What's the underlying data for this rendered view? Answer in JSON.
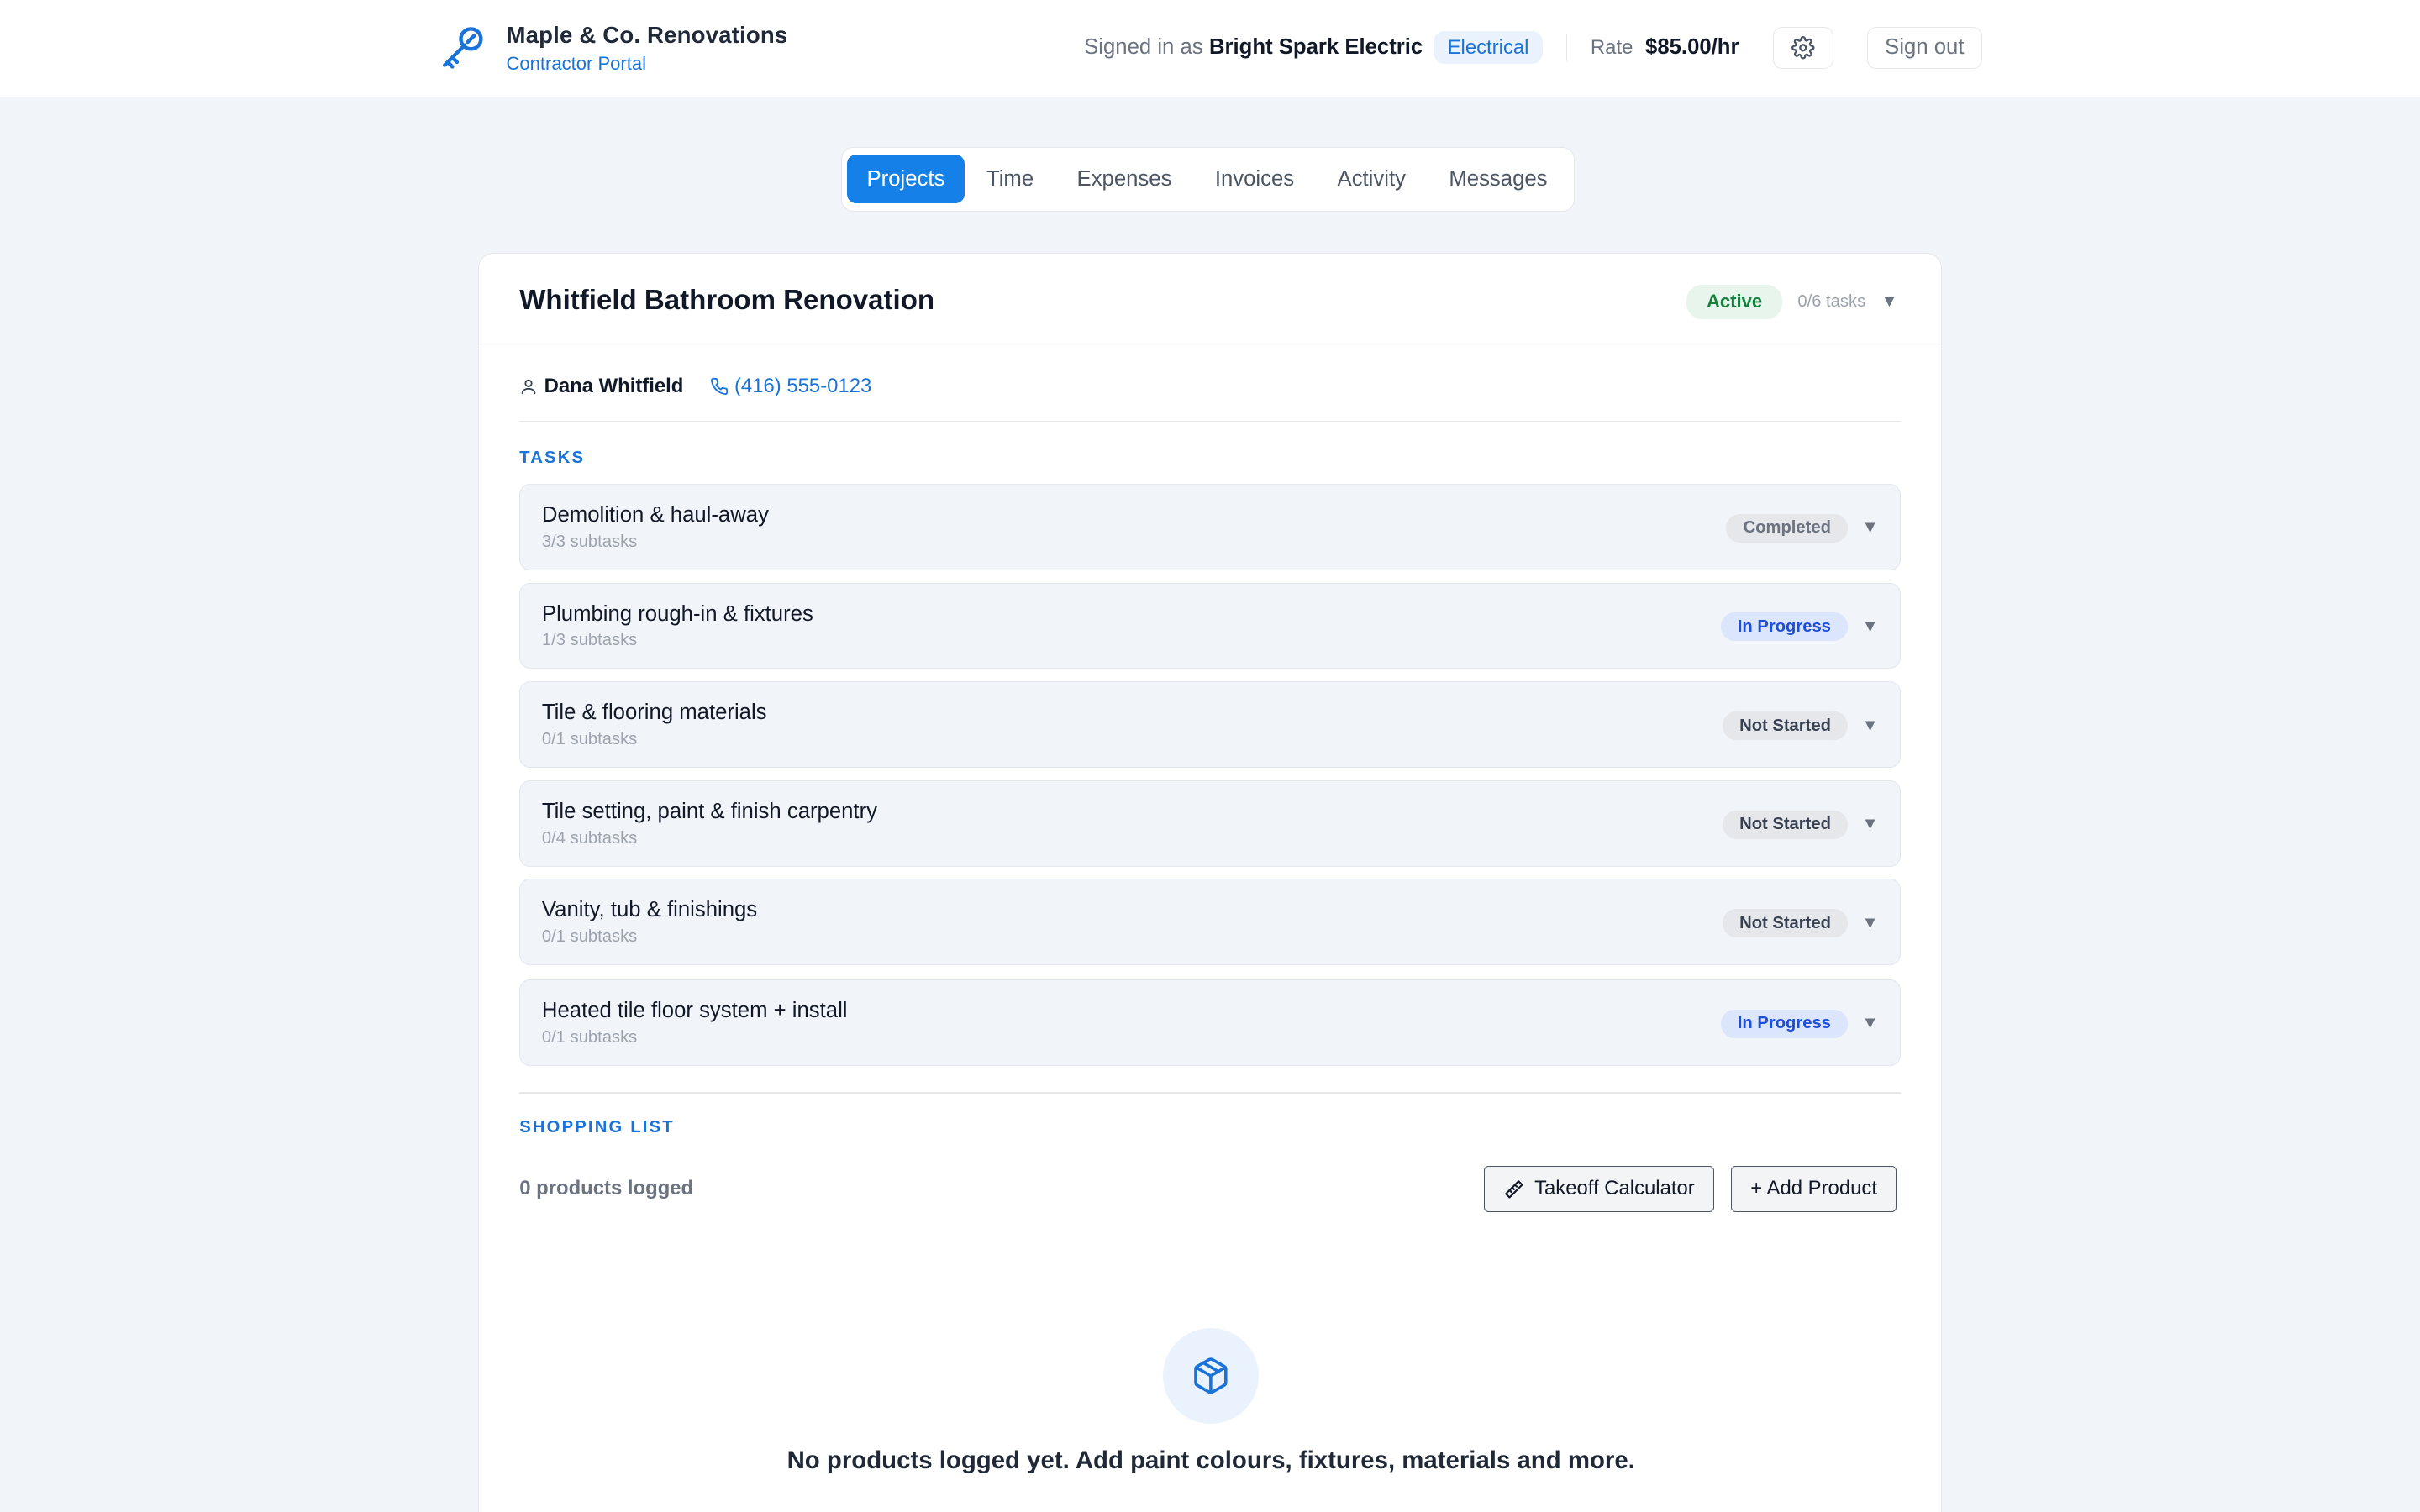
{
  "header": {
    "brand_name": "Maple & Co. Renovations",
    "brand_sub": "Contractor Portal",
    "signed_in_label": "Signed in as",
    "user_name": "Bright Spark Electric",
    "trade": "Electrical",
    "rate_label": "Rate",
    "rate_value": "$85.00/hr",
    "sign_out": "Sign out",
    "settings_icon": "gear-icon",
    "brand_icon": "key-icon"
  },
  "tabs": [
    {
      "label": "Projects",
      "active": true
    },
    {
      "label": "Time",
      "active": false
    },
    {
      "label": "Expenses",
      "active": false
    },
    {
      "label": "Invoices",
      "active": false
    },
    {
      "label": "Activity",
      "active": false
    },
    {
      "label": "Messages",
      "active": false
    }
  ],
  "project": {
    "title": "Whitfield Bathroom Renovation",
    "status": "Active",
    "task_count": "0/6 tasks",
    "client_name": "Dana Whitfield",
    "client_phone": "(416) 555-0123"
  },
  "tasks_section": {
    "label": "TASKS",
    "items": [
      {
        "name": "Demolition & haul-away",
        "subtasks": "3/3 subtasks",
        "status": "Completed"
      },
      {
        "name": "Plumbing rough-in & fixtures",
        "subtasks": "1/3 subtasks",
        "status": "In Progress"
      },
      {
        "name": "Tile & flooring materials",
        "subtasks": "0/1 subtasks",
        "status": "Not Started"
      },
      {
        "name": "Tile setting, paint & finish carpentry",
        "subtasks": "0/4 subtasks",
        "status": "Not Started"
      },
      {
        "name": "Vanity, tub & finishings",
        "subtasks": "0/1 subtasks",
        "status": "Not Started"
      },
      {
        "name": "Heated tile floor system + install",
        "subtasks": "0/1 subtasks",
        "status": "In Progress"
      }
    ]
  },
  "shopping": {
    "label": "SHOPPING LIST",
    "count": "0 products logged",
    "takeoff_button": "Takeoff Calculator",
    "add_button": "+ Add Product",
    "empty_text": "No products logged yet. Add paint colours, fixtures, materials and more."
  },
  "colors": {
    "accent": "#1580e8",
    "active_green": "#15803d",
    "in_progress_blue": "#1d4ed8"
  }
}
